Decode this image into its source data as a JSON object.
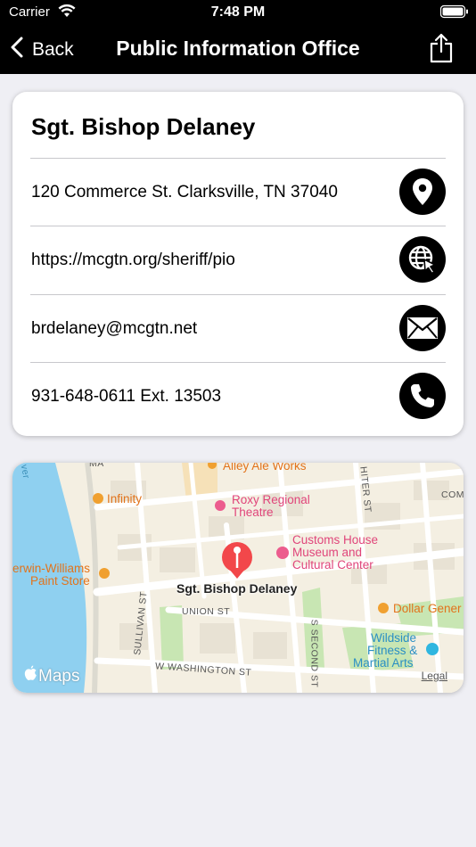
{
  "status_bar": {
    "carrier": "Carrier",
    "time": "7:48 PM"
  },
  "nav": {
    "back_label": "Back",
    "title": "Public Information Office",
    "share_icon": "share-icon"
  },
  "contact": {
    "name": "Sgt. Bishop Delaney",
    "rows": [
      {
        "text": "120 Commerce St. Clarksville, TN 37040",
        "icon": "location-pin-icon"
      },
      {
        "text": "https://mcgtn.org/sheriff/pio",
        "icon": "globe-cursor-icon"
      },
      {
        "text": "brdelaney@mcgtn.net",
        "icon": "envelope-icon"
      },
      {
        "text": "931-648-0611 Ext. 13503",
        "icon": "phone-icon"
      }
    ]
  },
  "map": {
    "pin_label": "Sgt. Bishop Delaney",
    "maps_logo": "Maps",
    "legal": "Legal",
    "pois": {
      "alley": "Alley Ale Works",
      "infinity": "Infinity",
      "roxy_1": "Roxy Regional",
      "roxy_2": "Theatre",
      "customs_1": "Customs House",
      "customs_2": "Museum and",
      "customs_3": "Cultural Center",
      "sherwin_1": "erwin-Williams",
      "sherwin_2": "Paint Store",
      "dollar": "Dollar Gener",
      "wildside_1": "Wildside",
      "wildside_2": "Fitness &",
      "wildside_3": "Martial Arts"
    },
    "streets": {
      "union": "UNION ST",
      "washington": "W WASHINGTON ST",
      "sullivan": "SULLIVAN ST",
      "second": "S SECOND ST",
      "hiter": "HITER ST",
      "com": "COM",
      "ver": "ver",
      "ma": "MA"
    }
  },
  "colors": {
    "nav_bg": "#000000",
    "page_bg": "#efeff4",
    "water": "#8fd0f0",
    "poi_orange": "#e2731b",
    "poi_pink": "#e0457a",
    "poi_blue": "#2a8fc4",
    "pin_red": "#f2474a",
    "park_green": "#c8e6b3"
  }
}
